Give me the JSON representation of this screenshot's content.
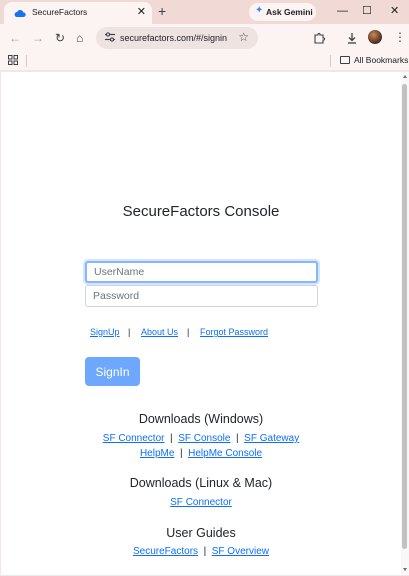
{
  "browser": {
    "tab_title": "SecureFactors",
    "new_tab_glyph": "+",
    "close_glyph": "✕",
    "gemini_label": "Ask Gemini",
    "window_controls": {
      "minimize": "—",
      "maximize": "☐",
      "close": "✕"
    },
    "url": "securefactors.com/#/signin",
    "bookmarks_label": "All Bookmarks"
  },
  "icons": {
    "back": "back-arrow-icon",
    "forward": "forward-arrow-icon",
    "reload": "reload-icon",
    "home": "home-icon",
    "site_info": "tune-icon",
    "bookmark_star": "star-icon",
    "extensions": "puzzle-icon",
    "download": "download-icon",
    "menu": "kebab-menu-icon",
    "apps": "apps-grid-icon",
    "folder": "folder-icon"
  },
  "page": {
    "title": "SecureFactors Console",
    "username_placeholder": "UserName",
    "password_placeholder": "Password",
    "links": {
      "signup": "SignUp",
      "about": "About Us",
      "forgot": "Forgot Password"
    },
    "separator": "|",
    "signin_label": "SignIn",
    "downloads_windows": {
      "heading": "Downloads (Windows)",
      "links": [
        "SF Connector",
        "SF Console",
        "SF Gateway",
        "HelpMe",
        "HelpMe Console"
      ]
    },
    "downloads_linux_mac": {
      "heading": "Downloads (Linux & Mac)",
      "links": [
        "SF Connector"
      ]
    },
    "user_guides": {
      "heading": "User Guides",
      "links": [
        "SecureFactors",
        "SF Overview"
      ]
    }
  },
  "colors": {
    "accent": "#0d6efd",
    "button": "#6ea8fe",
    "frame": "#f1d9d6"
  }
}
